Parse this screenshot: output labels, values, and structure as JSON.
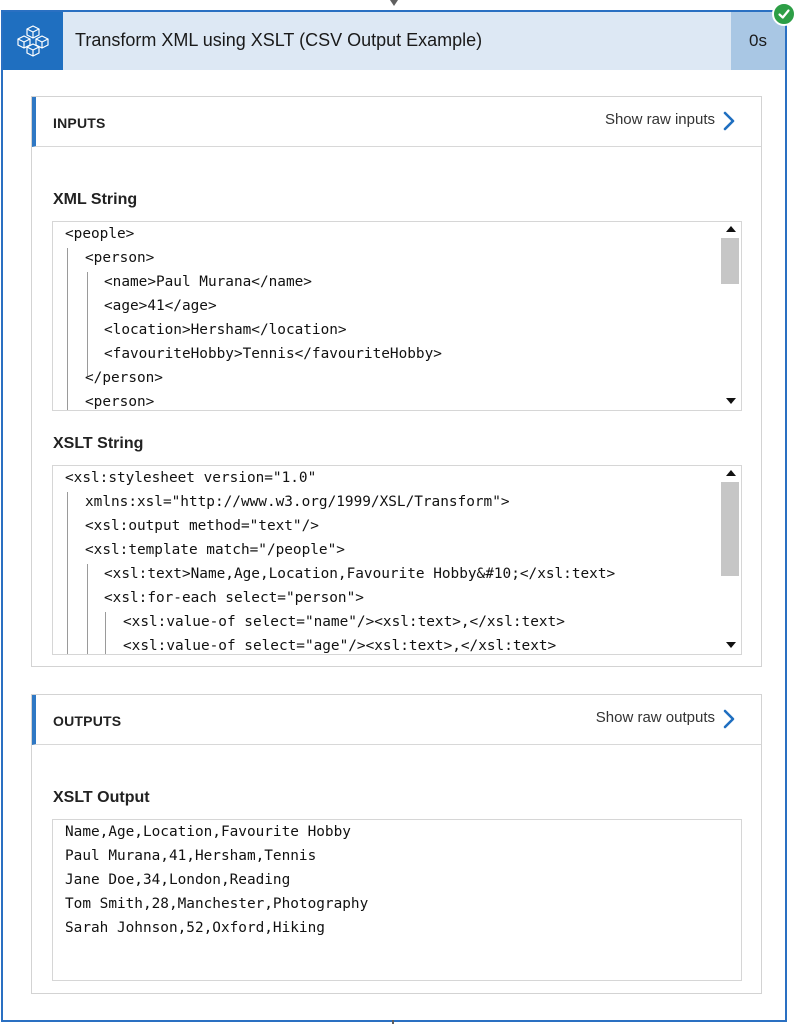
{
  "action": {
    "title": "Transform XML using XSLT (CSV Output Example)",
    "duration": "0s",
    "icon": "xslt-cubes-icon",
    "status": "succeeded",
    "status_icon": "check-icon"
  },
  "colors": {
    "accent": "#1f6fc0",
    "header_bg": "#dde8f4",
    "duration_bg": "#a9c7e4",
    "success": "#2d9e46"
  },
  "inputs": {
    "title": "INPUTS",
    "show_raw_label": "Show raw inputs",
    "xml_label": "XML String",
    "xml_lines": [
      "<people>",
      "<person>",
      "<name>Paul Murana</name>",
      "<age>41</age>",
      "<location>Hersham</location>",
      "<favouriteHobby>Tennis</favouriteHobby>",
      "</person>",
      "<person>"
    ],
    "xslt_label": "XSLT String",
    "xslt_lines": [
      "<xsl:stylesheet version=\"1.0\"",
      "xmlns:xsl=\"http://www.w3.org/1999/XSL/Transform\">",
      "<xsl:output method=\"text\"/>",
      "<xsl:template match=\"/people\">",
      "<xsl:text>Name,Age,Location,Favourite Hobby&#10;</xsl:text>",
      "<xsl:for-each select=\"person\">",
      "<xsl:value-of select=\"name\"/><xsl:text>,</xsl:text>",
      "<xsl:value-of select=\"age\"/><xsl:text>,</xsl:text>"
    ]
  },
  "outputs": {
    "title": "OUTPUTS",
    "show_raw_label": "Show raw outputs",
    "output_label": "XSLT Output",
    "output_lines": [
      "Name,Age,Location,Favourite Hobby",
      "Paul Murana,41,Hersham,Tennis",
      "Jane Doe,34,London,Reading",
      "Tom Smith,28,Manchester,Photography",
      "Sarah Johnson,52,Oxford,Hiking"
    ]
  }
}
